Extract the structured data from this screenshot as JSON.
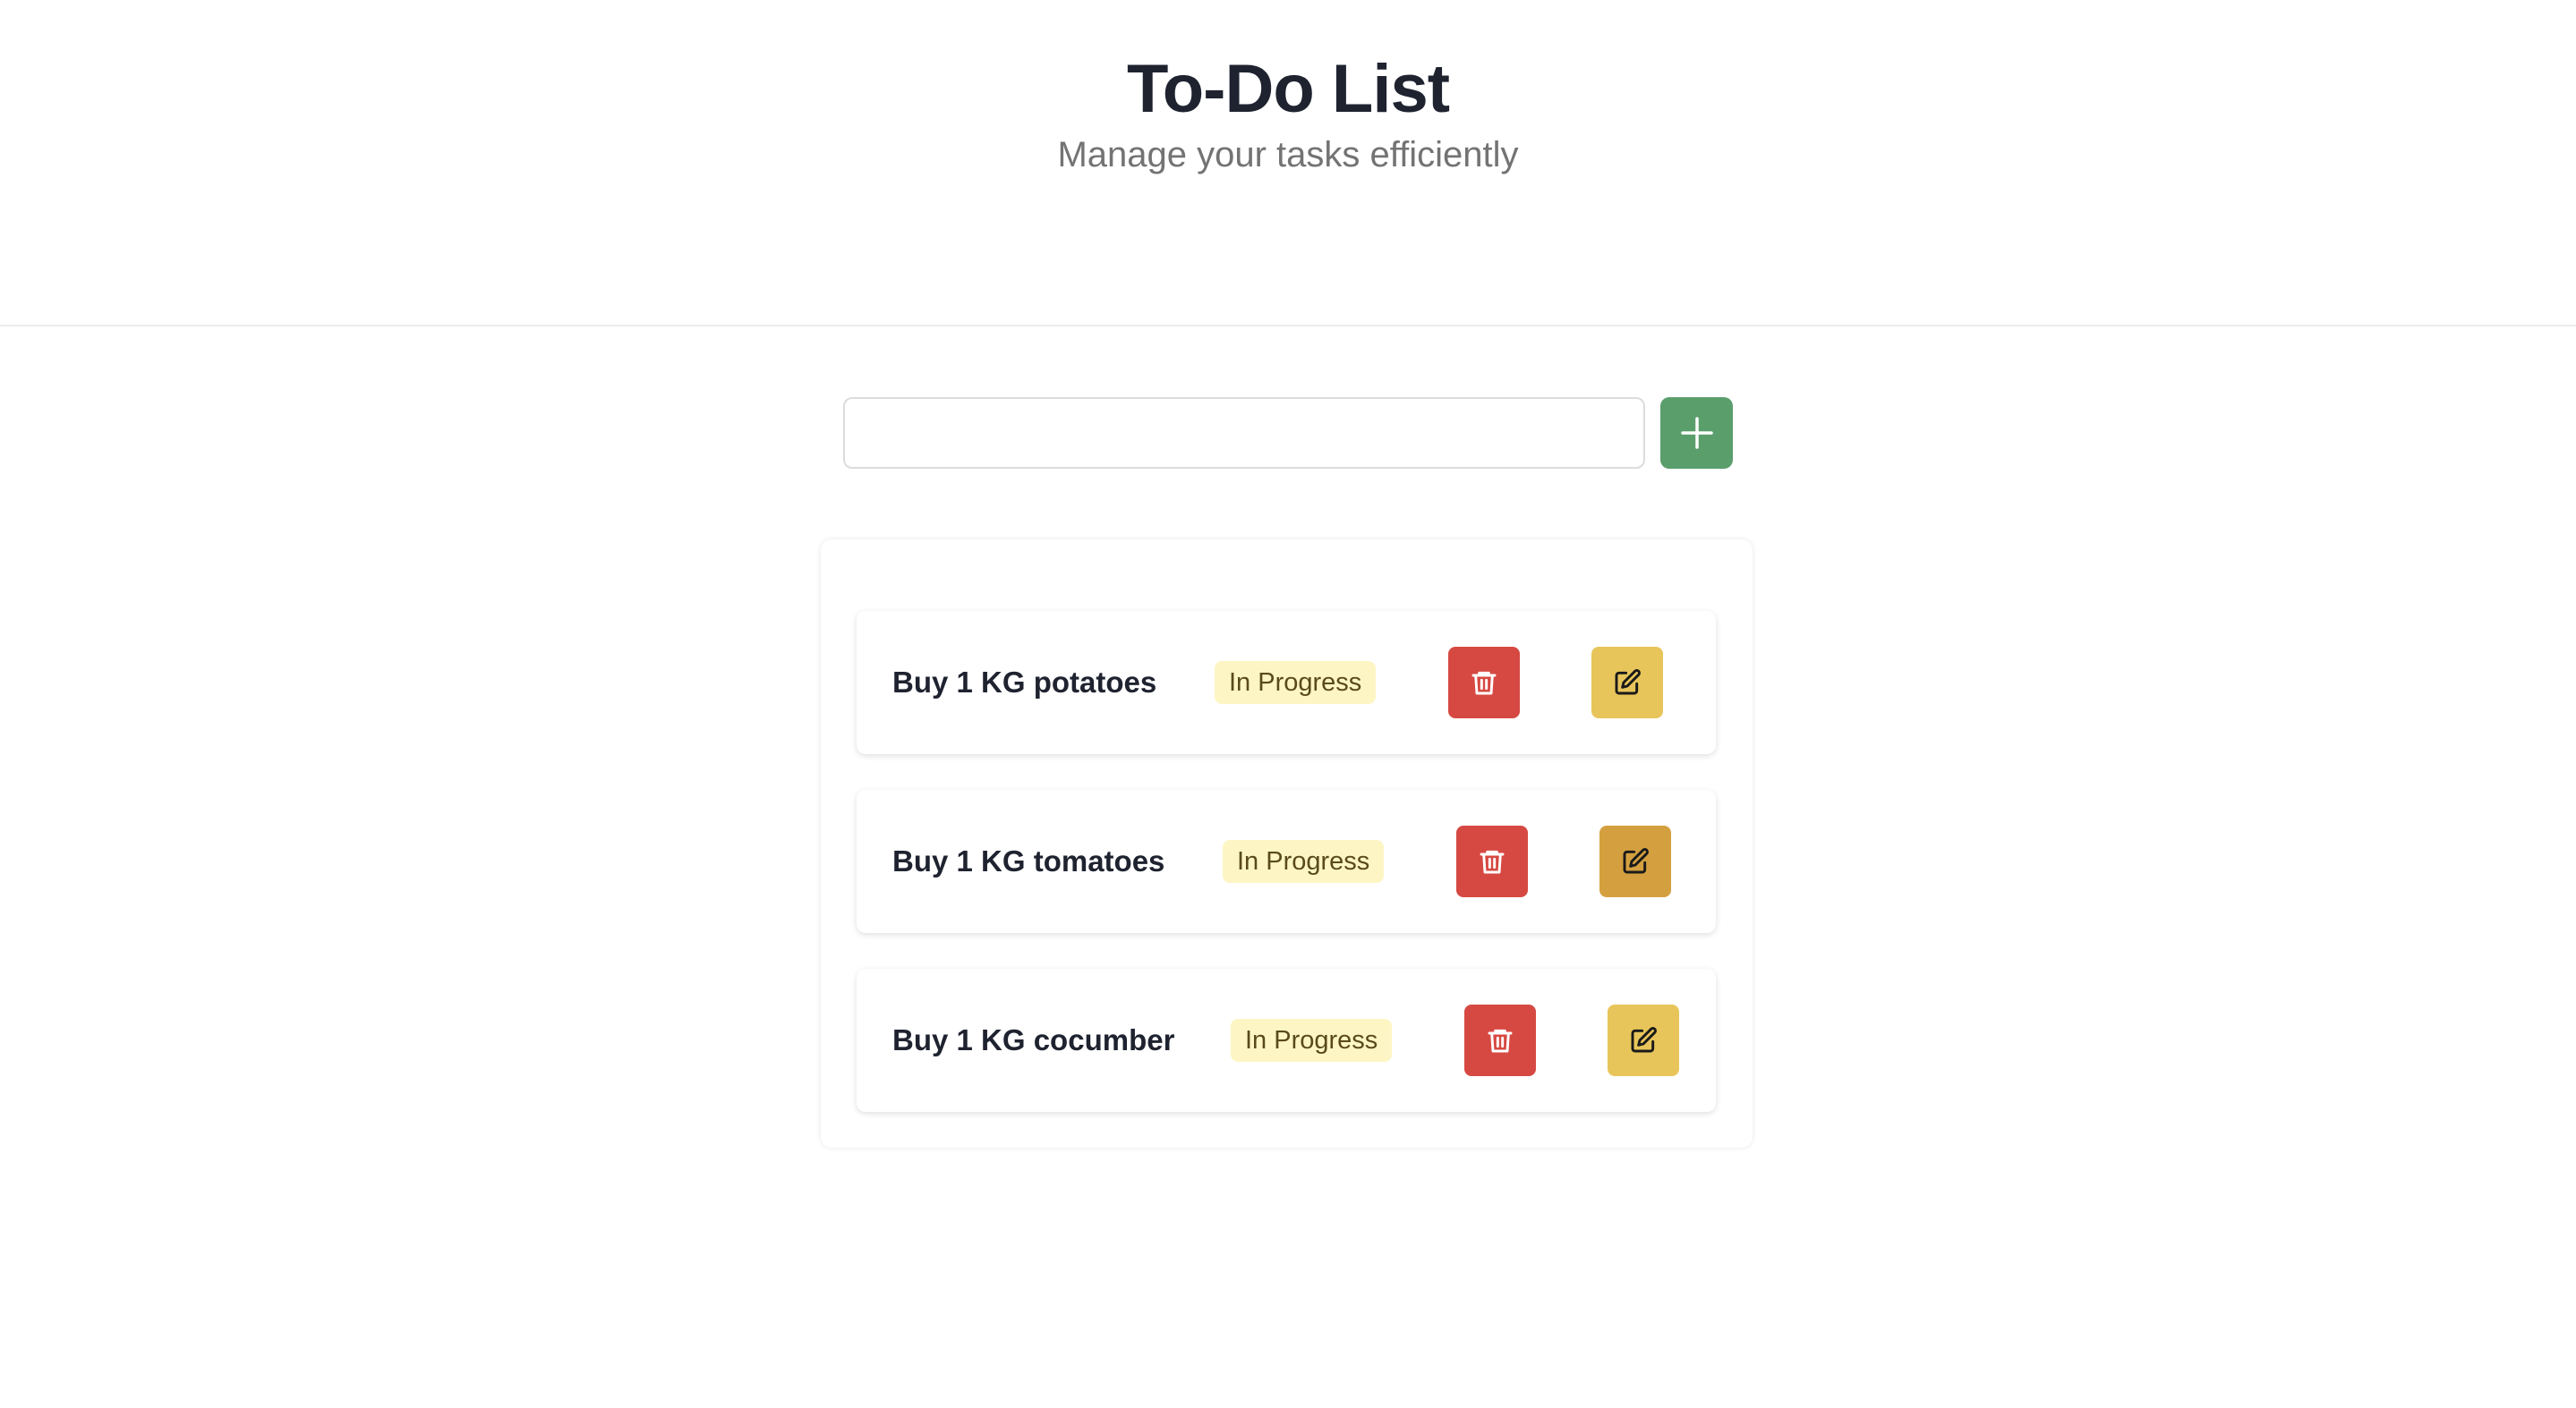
{
  "header": {
    "title": "To-Do List",
    "subtitle": "Manage your tasks efficiently"
  },
  "add_task": {
    "input_value": "",
    "input_placeholder": "",
    "add_icon": "plus-icon"
  },
  "tasks": [
    {
      "name": "Buy 1 KG potatoes",
      "status": "In Progress",
      "delete_icon": "trash-icon",
      "edit_icon": "edit-icon"
    },
    {
      "name": "Buy 1 KG tomatoes",
      "status": "In Progress",
      "delete_icon": "trash-icon",
      "edit_icon": "edit-icon"
    },
    {
      "name": "Buy 1 KG cocumber",
      "status": "In Progress",
      "delete_icon": "trash-icon",
      "edit_icon": "edit-icon"
    }
  ],
  "colors": {
    "add_button": "#5a9e6c",
    "delete_button": "#d64942",
    "edit_button": "#e8c55a",
    "edit_button_hover": "#d4a03f",
    "status_badge_bg": "#fdf6c4",
    "status_badge_text": "#5a4a1a"
  }
}
